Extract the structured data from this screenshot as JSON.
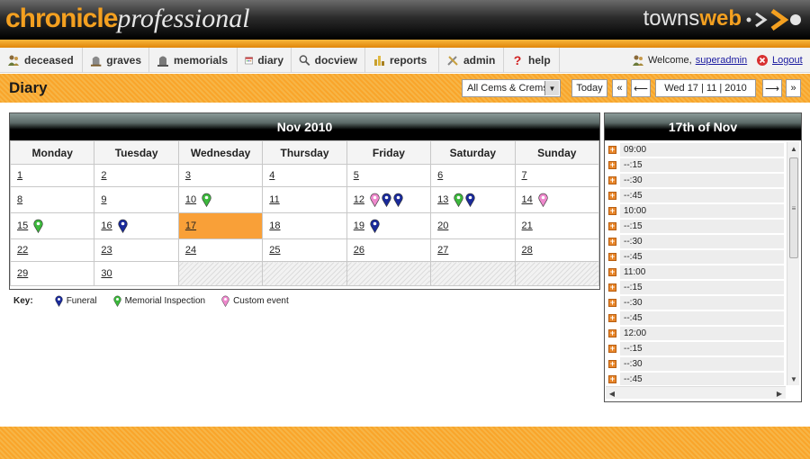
{
  "brand": {
    "part1": "chronicle",
    "part2": "professional",
    "vendor1": "towns",
    "vendor2": "web"
  },
  "colors": {
    "accent": "#f4a020",
    "today": "#f9a038",
    "funeral": "#1a2a9a",
    "memorial": "#3cb83c",
    "custom": "#ee88cc"
  },
  "menu": {
    "items": [
      {
        "label": "deceased",
        "icon": "people-icon"
      },
      {
        "label": "graves",
        "icon": "grave-icon"
      },
      {
        "label": "memorials",
        "icon": "memorial-icon"
      },
      {
        "label": "diary",
        "icon": "diary-icon"
      },
      {
        "label": "docview",
        "icon": "magnifier-icon"
      },
      {
        "label": "reports",
        "icon": "reports-icon"
      },
      {
        "label": "admin",
        "icon": "tools-icon"
      },
      {
        "label": "help",
        "icon": "question-icon"
      }
    ],
    "welcome_text": "Welcome,",
    "user": "superadmin",
    "logout": "Logout"
  },
  "page": {
    "title": "Diary",
    "cem_select": "All Cems & Crems",
    "today_label": "Today",
    "prev_month": "«",
    "prev_day": "⟵",
    "date_display": "Wed 17 | 11 | 2010",
    "next_day": "⟶",
    "next_month": "»"
  },
  "calendar": {
    "month_title": "Nov 2010",
    "weekdays": [
      "Monday",
      "Tuesday",
      "Wednesday",
      "Thursday",
      "Friday",
      "Saturday",
      "Sunday"
    ],
    "weeks": [
      [
        {
          "day": "1",
          "events": []
        },
        {
          "day": "2",
          "events": []
        },
        {
          "day": "3",
          "events": []
        },
        {
          "day": "4",
          "events": []
        },
        {
          "day": "5",
          "events": []
        },
        {
          "day": "6",
          "events": []
        },
        {
          "day": "7",
          "events": []
        }
      ],
      [
        {
          "day": "8",
          "events": []
        },
        {
          "day": "9",
          "events": []
        },
        {
          "day": "10",
          "events": [
            "memorial"
          ]
        },
        {
          "day": "11",
          "events": []
        },
        {
          "day": "12",
          "events": [
            "custom",
            "funeral",
            "funeral"
          ]
        },
        {
          "day": "13",
          "events": [
            "memorial",
            "funeral"
          ]
        },
        {
          "day": "14",
          "events": [
            "custom"
          ]
        }
      ],
      [
        {
          "day": "15",
          "events": [
            "memorial"
          ]
        },
        {
          "day": "16",
          "events": [
            "funeral"
          ]
        },
        {
          "day": "17",
          "events": [],
          "today": true
        },
        {
          "day": "18",
          "events": []
        },
        {
          "day": "19",
          "events": [
            "funeral"
          ]
        },
        {
          "day": "20",
          "events": []
        },
        {
          "day": "21",
          "events": []
        }
      ],
      [
        {
          "day": "22",
          "events": []
        },
        {
          "day": "23",
          "events": []
        },
        {
          "day": "24",
          "events": []
        },
        {
          "day": "25",
          "events": []
        },
        {
          "day": "26",
          "events": []
        },
        {
          "day": "27",
          "events": []
        },
        {
          "day": "28",
          "events": []
        }
      ],
      [
        {
          "day": "29",
          "events": []
        },
        {
          "day": "30",
          "events": []
        },
        {
          "day": "",
          "events": []
        },
        {
          "day": "",
          "events": []
        },
        {
          "day": "",
          "events": []
        },
        {
          "day": "",
          "events": []
        },
        {
          "day": "",
          "events": []
        }
      ]
    ]
  },
  "key": {
    "label": "Key:",
    "items": [
      {
        "type": "funeral",
        "label": "Funeral"
      },
      {
        "type": "memorial",
        "label": "Memorial Inspection"
      },
      {
        "type": "custom",
        "label": "Custom event"
      }
    ]
  },
  "day_panel": {
    "title": "17th of Nov",
    "slots": [
      "09:00",
      "--:15",
      "--:30",
      "--:45",
      "10:00",
      "--:15",
      "--:30",
      "--:45",
      "11:00",
      "--:15",
      "--:30",
      "--:45",
      "12:00",
      "--:15",
      "--:30",
      "--:45"
    ]
  }
}
